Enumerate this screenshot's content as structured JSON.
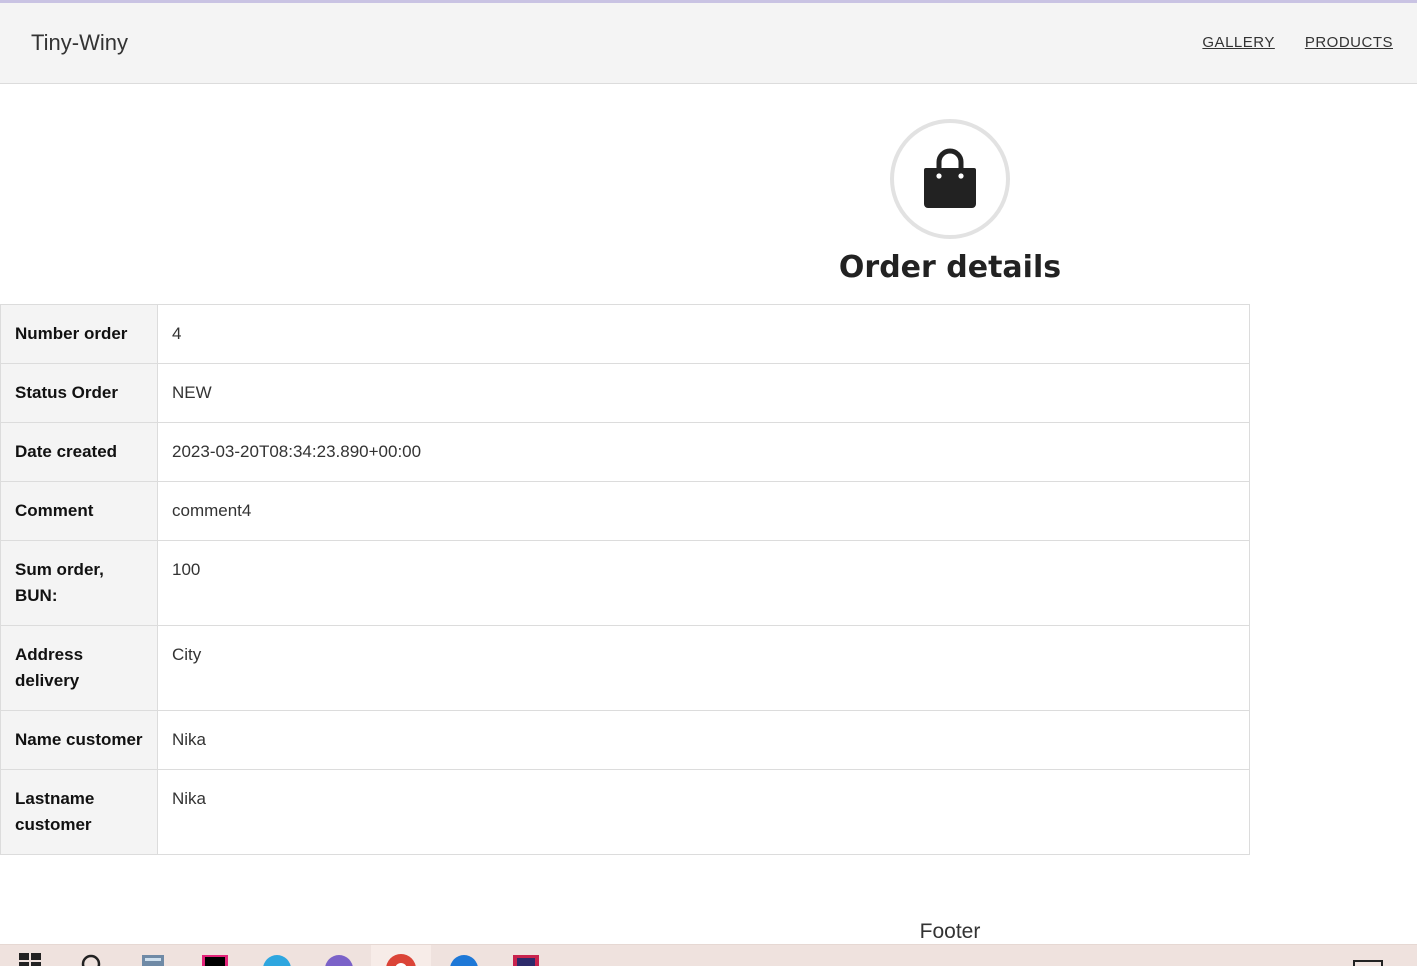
{
  "header": {
    "brand": "Tiny-Winy",
    "nav": [
      {
        "label": "GALLERY"
      },
      {
        "label": "PRODUCTS"
      }
    ]
  },
  "page": {
    "icon": "shopping-bag-icon",
    "title": "Order details"
  },
  "order": {
    "rows": [
      {
        "key": "Number order",
        "value": "4"
      },
      {
        "key": "Status Order",
        "value": "NEW"
      },
      {
        "key": "Date created",
        "value": "2023-03-20T08:34:23.890+00:00"
      },
      {
        "key": "Comment",
        "value": "comment4"
      },
      {
        "key": "Sum order, BUN:",
        "value": "100"
      },
      {
        "key": "Address delivery",
        "value": "City"
      },
      {
        "key": "Name customer",
        "value": "Nika"
      },
      {
        "key": "Lastname customer",
        "value": "Nika"
      }
    ]
  },
  "footer": {
    "text": "Footer"
  },
  "taskbar": {
    "items": [
      "windows-start-icon",
      "search-icon",
      "calculator-icon",
      "intellij-icon",
      "telegram-icon",
      "viber-icon",
      "chrome-icon",
      "app-icon",
      "app-icon"
    ]
  }
}
